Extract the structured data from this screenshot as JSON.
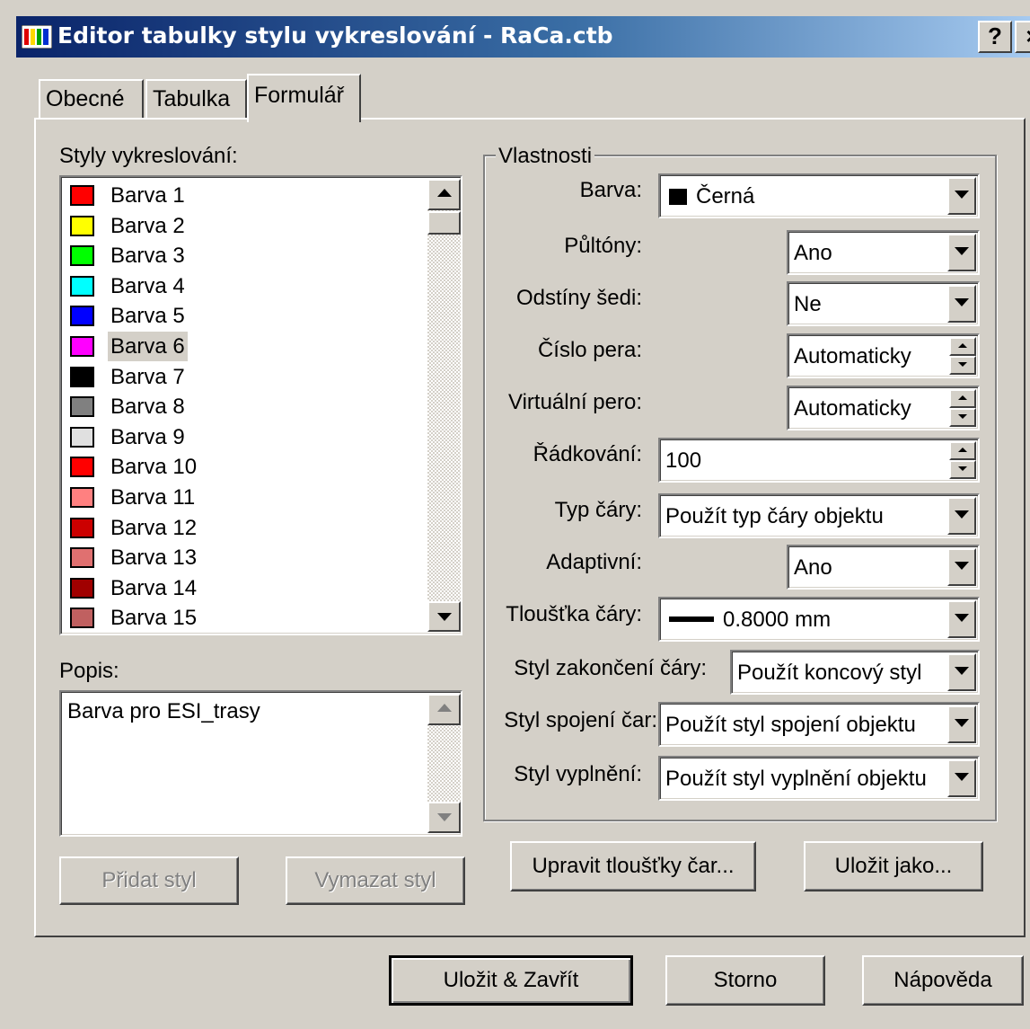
{
  "window": {
    "title": "Editor tabulky stylu vykreslování - RaCa.ctb",
    "help_label": "?",
    "close_label": "×"
  },
  "tabs": [
    {
      "label": "Obecné"
    },
    {
      "label": "Tabulka"
    },
    {
      "label": "Formulář",
      "active": true
    }
  ],
  "styles": {
    "label": "Styly vykreslování:",
    "selected": "Barva 6",
    "items": [
      {
        "label": "Barva 1",
        "color": "#ff0000"
      },
      {
        "label": "Barva 2",
        "color": "#ffff00"
      },
      {
        "label": "Barva 3",
        "color": "#00ff00"
      },
      {
        "label": "Barva 4",
        "color": "#00ffff"
      },
      {
        "label": "Barva 5",
        "color": "#0000ff"
      },
      {
        "label": "Barva 6",
        "color": "#ff00ff"
      },
      {
        "label": "Barva 7",
        "color": "#000000"
      },
      {
        "label": "Barva 8",
        "color": "#808080"
      },
      {
        "label": "Barva 9",
        "color": "#e0e0e0"
      },
      {
        "label": "Barva 10",
        "color": "#ff0000"
      },
      {
        "label": "Barva 11",
        "color": "#ff8080"
      },
      {
        "label": "Barva 12",
        "color": "#cc0000"
      },
      {
        "label": "Barva 13",
        "color": "#e07070"
      },
      {
        "label": "Barva 14",
        "color": "#a00000"
      },
      {
        "label": "Barva 15",
        "color": "#c06060"
      }
    ]
  },
  "description": {
    "label": "Popis:",
    "value": "Barva pro ESI_trasy"
  },
  "buttons": {
    "add_style": "Přidat styl",
    "delete_style": "Vymazat styl",
    "edit_lineweights": "Upravit tloušťky čar...",
    "save_as": "Uložit jako...",
    "save_close": "Uložit & Zavřít",
    "cancel": "Storno",
    "help": "Nápověda"
  },
  "properties": {
    "group_label": "Vlastnosti",
    "color": {
      "label": "Barva:",
      "value": "Černá",
      "swatch": "#000000"
    },
    "dither": {
      "label": "Půltóny:",
      "value": "Ano"
    },
    "grayscale": {
      "label": "Odstíny šedi:",
      "value": "Ne"
    },
    "pen_number": {
      "label": "Číslo pera:",
      "value": "Automaticky"
    },
    "virtual_pen": {
      "label": "Virtuální pero:",
      "value": "Automaticky"
    },
    "screening": {
      "label": "Řádkování:",
      "value": "100"
    },
    "linetype": {
      "label": "Typ čáry:",
      "value": "Použít typ čáry objektu"
    },
    "adaptive": {
      "label": "Adaptivní:",
      "value": "Ano"
    },
    "lineweight": {
      "label": "Tloušťka čáry:",
      "value": "0.8000 mm"
    },
    "line_end": {
      "label": "Styl zakončení čáry:",
      "value": "Použít koncový styl"
    },
    "line_join": {
      "label": "Styl spojení čar:",
      "value": "Použít styl spojení objektu"
    },
    "fill": {
      "label": "Styl vyplnění:",
      "value": "Použít styl vyplnění objektu"
    }
  }
}
